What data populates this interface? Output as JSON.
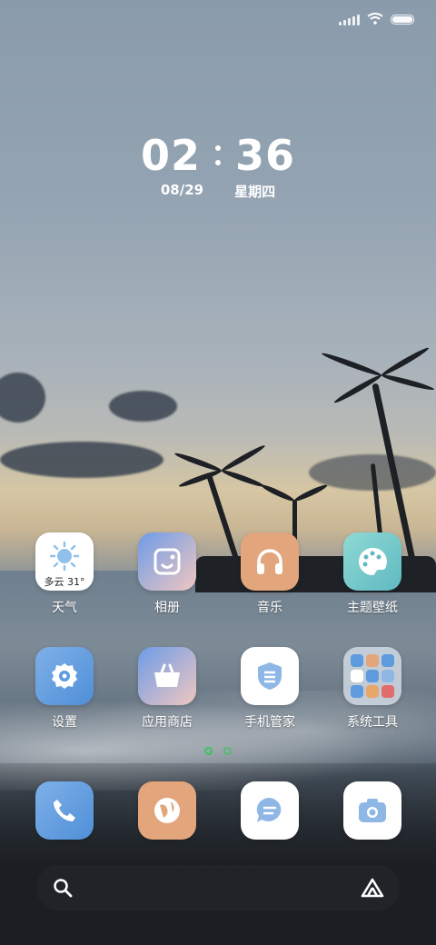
{
  "status_bar": {
    "icons": [
      "signal-icon",
      "wifi-icon",
      "battery-icon"
    ]
  },
  "clock": {
    "hour": "02",
    "minute": "36",
    "date": "08/29",
    "weekday": "星期四"
  },
  "apps_row1": [
    {
      "label": "天气",
      "icon": "weather-icon",
      "widget_text": "多云 31°"
    },
    {
      "label": "相册",
      "icon": "gallery-icon"
    },
    {
      "label": "音乐",
      "icon": "headphones-icon"
    },
    {
      "label": "主题壁纸",
      "icon": "palette-icon"
    }
  ],
  "apps_row2": [
    {
      "label": "设置",
      "icon": "gear-icon"
    },
    {
      "label": "应用商店",
      "icon": "shopping-bag-icon"
    },
    {
      "label": "手机管家",
      "icon": "shield-icon"
    },
    {
      "label": "系统工具",
      "icon": "folder-icon"
    }
  ],
  "dock": [
    {
      "icon": "phone-icon"
    },
    {
      "icon": "browser-icon"
    },
    {
      "icon": "message-icon"
    },
    {
      "icon": "camera-icon"
    }
  ],
  "search": {
    "icons": [
      "search-icon",
      "assistant-icon"
    ]
  },
  "colors": {
    "dot": "#39c45a"
  }
}
